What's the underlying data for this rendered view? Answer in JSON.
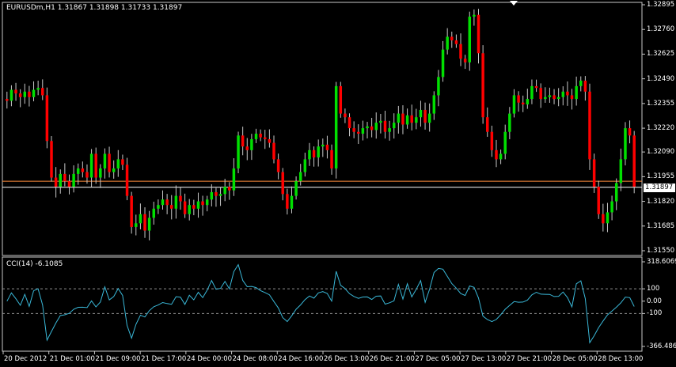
{
  "main_title": "EURUSDm,H1  1.31867 1.31898 1.31733 1.31897",
  "cci_title": "CCI(14) -6.1085",
  "current_price_label": "1.31897",
  "colors": {
    "background": "#000000",
    "frame": "#c8c8c8",
    "bull": "#00e000",
    "bear": "#ff0000",
    "wick": "#c8c8c8",
    "bid_line": "#ffffff",
    "ask_line": "#ff8c3a",
    "cci_line": "#3ab8d8",
    "cci_level": "#909090"
  },
  "chart_data": [
    {
      "type": "candlestick",
      "symbol": "EURUSDm",
      "timeframe": "H1",
      "ohlc_header": {
        "open": 1.31867,
        "high": 1.31898,
        "low": 1.31733,
        "close": 1.31897
      },
      "y_ticks": [
        "1.32895",
        "1.32760",
        "1.32625",
        "1.32490",
        "1.32355",
        "1.32220",
        "1.32090",
        "1.31955",
        "1.31820",
        "1.31685",
        "1.31550"
      ],
      "ylim": [
        1.3155,
        1.32895
      ],
      "bid": 1.31897,
      "ask": 1.3193,
      "x_labels": [
        "20 Dec 2012",
        "21 Dec 01:00",
        "21 Dec 09:00",
        "21 Dec 17:00",
        "24 Dec 00:00",
        "24 Dec 08:00",
        "24 Dec 16:00",
        "26 Dec 13:00",
        "26 Dec 21:00",
        "27 Dec 05:00",
        "27 Dec 13:00",
        "27 Dec 21:00",
        "28 Dec 05:00",
        "28 Dec 13:00"
      ],
      "series": [
        {
          "closes": [
            1.3237,
            1.3243,
            1.3241,
            1.3239,
            1.3242,
            1.3239,
            1.3243,
            1.3244,
            1.324,
            1.3215,
            1.3195,
            1.319,
            1.3197,
            1.3193,
            1.319,
            1.3197,
            1.32,
            1.3198,
            1.3195,
            1.3208,
            1.3195,
            1.32,
            1.3208,
            1.3198,
            1.32,
            1.3205,
            1.3202,
            1.3185,
            1.3168,
            1.317,
            1.3175,
            1.3166,
            1.3173,
            1.3178,
            1.318,
            1.3183,
            1.318,
            1.3178,
            1.3185,
            1.3182,
            1.3175,
            1.318,
            1.3178,
            1.3182,
            1.318,
            1.3183,
            1.3187,
            1.3185,
            1.3186,
            1.319,
            1.3188,
            1.32,
            1.3218,
            1.3212,
            1.321,
            1.3216,
            1.3219,
            1.3217,
            1.3216,
            1.3214,
            1.3205,
            1.3198,
            1.3186,
            1.3178,
            1.3185,
            1.3193,
            1.3198,
            1.3205,
            1.321,
            1.3206,
            1.3212,
            1.3213,
            1.321,
            1.32,
            1.3245,
            1.323,
            1.3228,
            1.3222,
            1.322,
            1.3219,
            1.3222,
            1.3223,
            1.3221,
            1.3225,
            1.3226,
            1.322,
            1.3222,
            1.3225,
            1.323,
            1.3224,
            1.3229,
            1.3225,
            1.3228,
            1.3232,
            1.3225,
            1.323,
            1.324,
            1.325,
            1.3265,
            1.3272,
            1.327,
            1.3268,
            1.326,
            1.3258,
            1.3283,
            1.3284,
            1.3263,
            1.3228,
            1.322,
            1.321,
            1.3205,
            1.3208,
            1.322,
            1.323,
            1.324,
            1.3236,
            1.3235,
            1.3238,
            1.3245,
            1.3244,
            1.3238,
            1.3239,
            1.324,
            1.3238,
            1.3239,
            1.3242,
            1.324,
            1.3238,
            1.3245,
            1.3248,
            1.3242,
            1.3205,
            1.319,
            1.3175,
            1.317,
            1.3176,
            1.3182,
            1.3192,
            1.3205,
            1.3222,
            1.3218,
            1.319
          ]
        },
        {
          "name": "CCI(14)",
          "value": -6.1085,
          "ylim": [
            -366.4865,
            318.6069
          ],
          "levels": [
            100,
            0.0,
            -100
          ]
        }
      ]
    }
  ],
  "cci_ticks": [
    "318.6069",
    "100",
    "0.00",
    "-100",
    "-366.4865"
  ]
}
